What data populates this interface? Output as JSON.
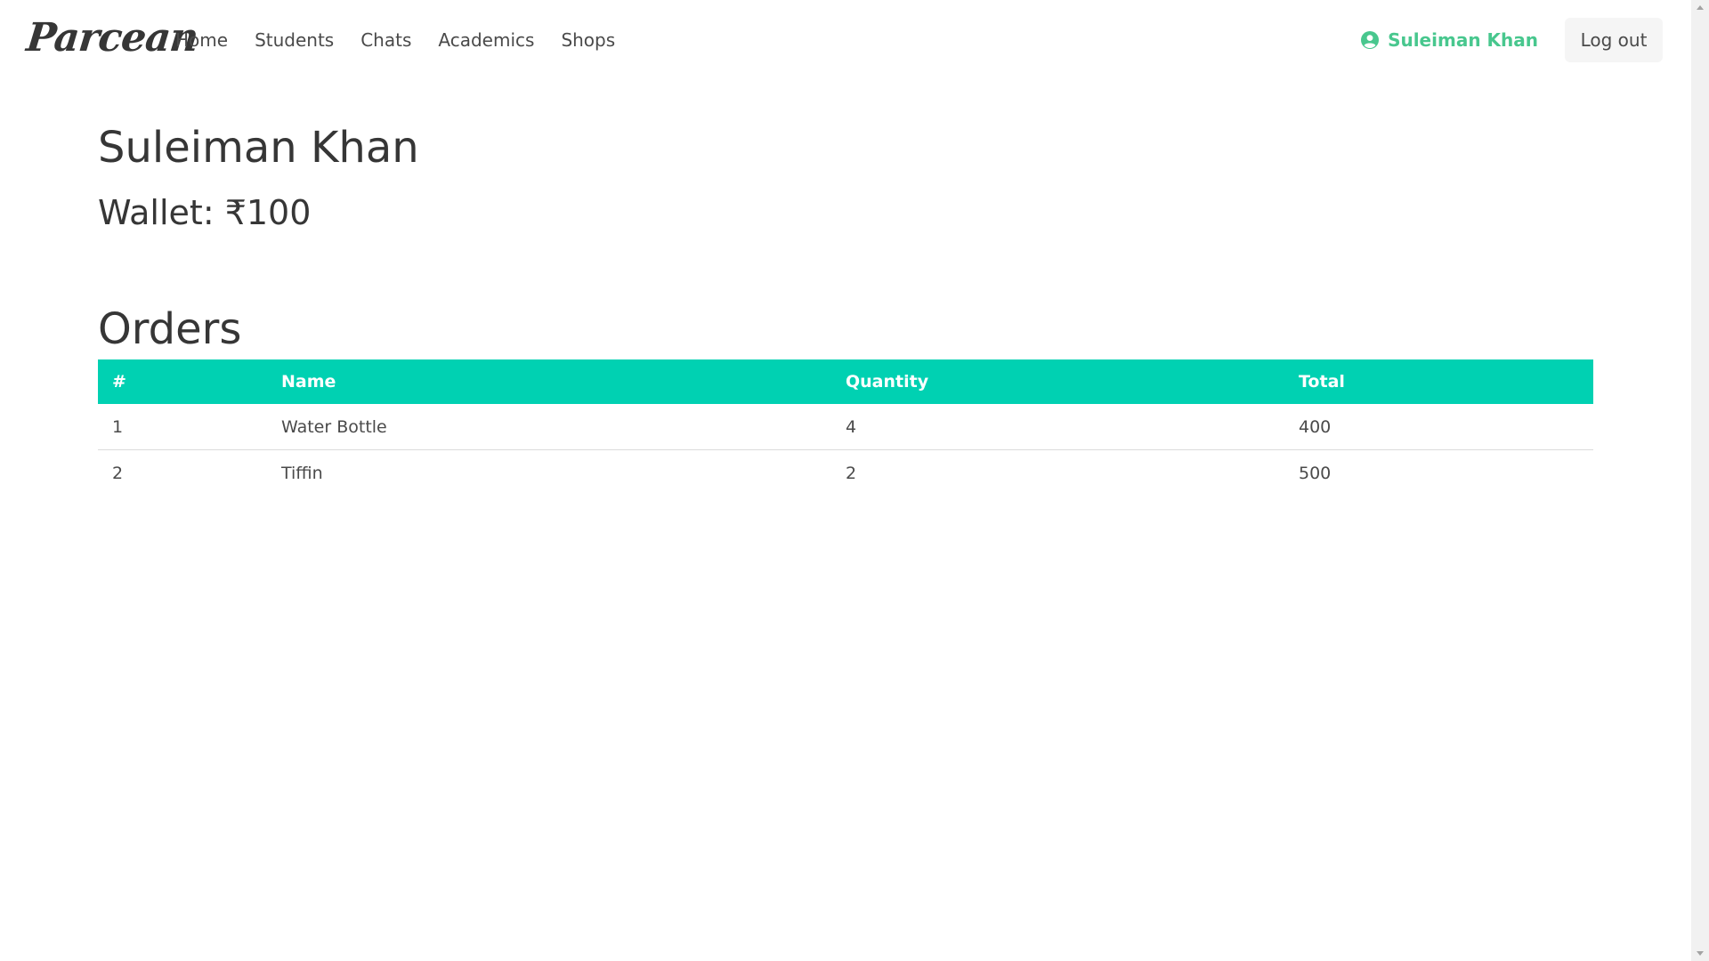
{
  "navbar": {
    "brand": "Parcean",
    "links": [
      "Home",
      "Students",
      "Chats",
      "Academics",
      "Shops"
    ],
    "user_name": "Suleiman Khan",
    "logout_label": "Log out",
    "accent_color": "#48c78e"
  },
  "profile": {
    "name": "Suleiman Khan",
    "wallet": "Wallet: ₹100"
  },
  "orders": {
    "title": "Orders",
    "header_color": "#00d1b2",
    "columns": [
      "#",
      "Name",
      "Quantity",
      "Total"
    ],
    "rows": [
      [
        "1",
        "Water Bottle",
        "4",
        "400"
      ],
      [
        "2",
        "Tiffin",
        "2",
        "500"
      ]
    ]
  },
  "icons": {
    "user": "user-circle-icon"
  }
}
